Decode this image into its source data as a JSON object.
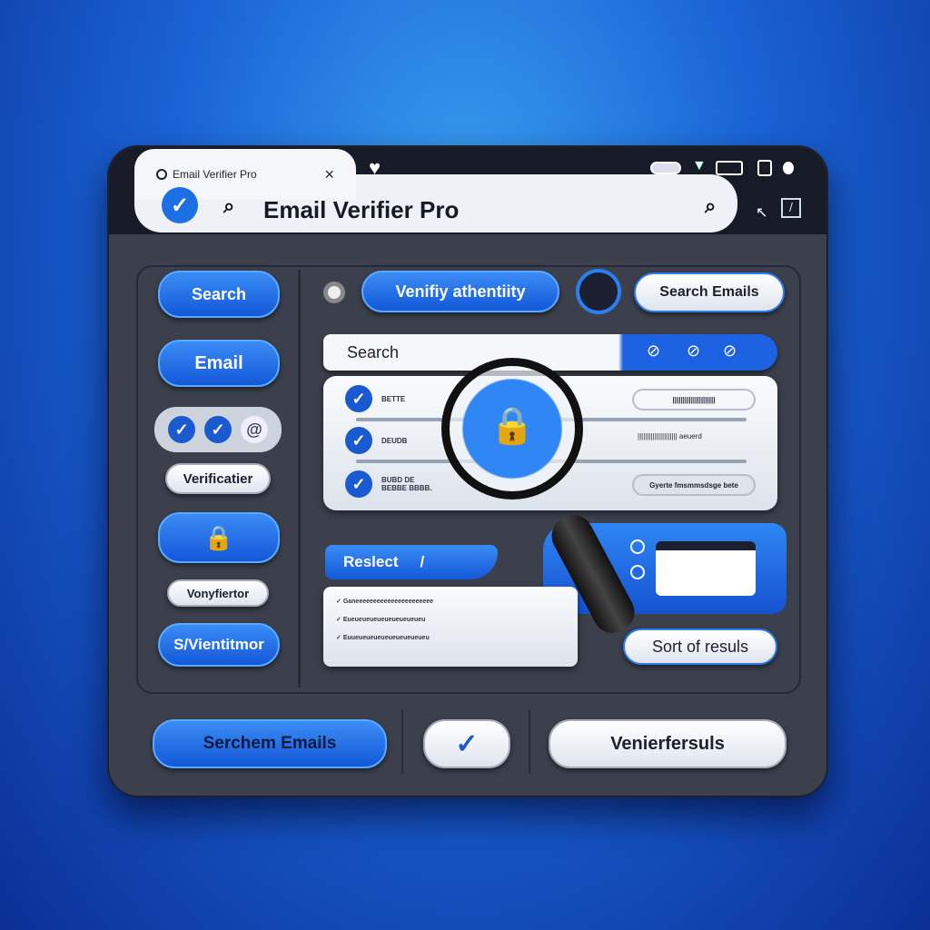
{
  "browser": {
    "tab_title": "Email Verifier Pro",
    "close_icon": "×",
    "address": "Email Verifier Pro"
  },
  "sidebar": {
    "items": [
      {
        "label": "Search"
      },
      {
        "label": "Email"
      },
      {
        "label": "Verificatier"
      },
      {
        "label": "Vonyfiertor"
      },
      {
        "label": "S/Vientitmor"
      }
    ]
  },
  "toolbar": {
    "verify_label": "Venifiy athentiity",
    "search_emails_label": "Search Emails"
  },
  "search": {
    "placeholder": "Search"
  },
  "results": {
    "rows": [
      {
        "label": "BETTE",
        "detail": "|||||||||||||||||||||"
      },
      {
        "label": "DEUDB",
        "detail": "||||||||||||||||||||| aeuerd"
      },
      {
        "label": "BUBD DE BEBBE BBBB.",
        "detail": "Gyerte fmsmmsdsge bete"
      }
    ]
  },
  "result_section": {
    "title": "Reslect",
    "list": [
      "Ganeeeeeeeeeeeeeeeeeeeeee",
      "Eueueueueueueueueueueu",
      "Euueueueueueueueueueueu"
    ],
    "sort_label": "Sort of resuls"
  },
  "footer": {
    "search_label": "Serchem Emails",
    "verify_label": "Venierfersuls"
  },
  "colors": {
    "accent": "#1a63e0",
    "window": "#3b404c",
    "topbar": "#171b27"
  }
}
